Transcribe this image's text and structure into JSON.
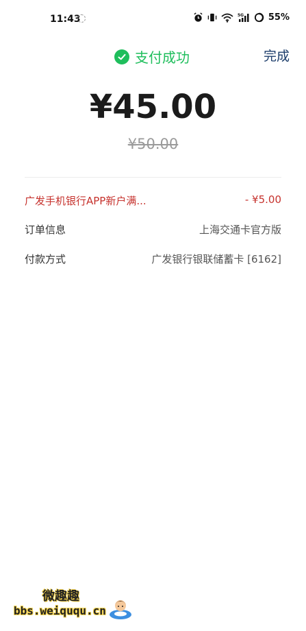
{
  "status_bar": {
    "time": "11:43",
    "battery": "55%",
    "icons": [
      "alarm-icon",
      "vibrate-icon",
      "wifi-icon",
      "signal-5g-icon",
      "battery-icon"
    ]
  },
  "header": {
    "title": "支付成功",
    "done_label": "完成",
    "success_color": "#1fbe5c"
  },
  "amount": {
    "paid": "¥45.00",
    "original": "¥50.00"
  },
  "details": {
    "discount": {
      "label": "广发手机银行APP新户满...",
      "value": "- ¥5.00",
      "color": "#c6322d"
    },
    "order": {
      "label": "订单信息",
      "value": "上海交通卡官方版"
    },
    "payment": {
      "label": "付款方式",
      "value": "广发银行银联储蓄卡 [6162]"
    }
  },
  "watermark": {
    "brand": "微趣趣",
    "site": "bbs.weiququ.cn"
  }
}
